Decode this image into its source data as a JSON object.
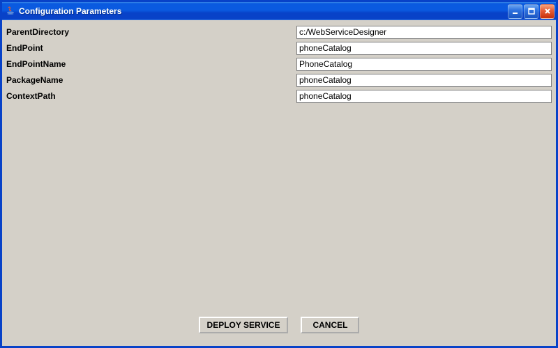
{
  "window": {
    "title": "Configuration Parameters"
  },
  "fields": {
    "parentDirectory": {
      "label": "ParentDirectory",
      "value": "c:/WebServiceDesigner"
    },
    "endPoint": {
      "label": "EndPoint",
      "value": "phoneCatalog"
    },
    "endPointName": {
      "label": "EndPointName",
      "value": "PhoneCatalog"
    },
    "packageName": {
      "label": "PackageName",
      "value": "phoneCatalog"
    },
    "contextPath": {
      "label": "ContextPath",
      "value": "phoneCatalog"
    }
  },
  "buttons": {
    "deploy": "DEPLOY SERVICE",
    "cancel": "CANCEL"
  }
}
